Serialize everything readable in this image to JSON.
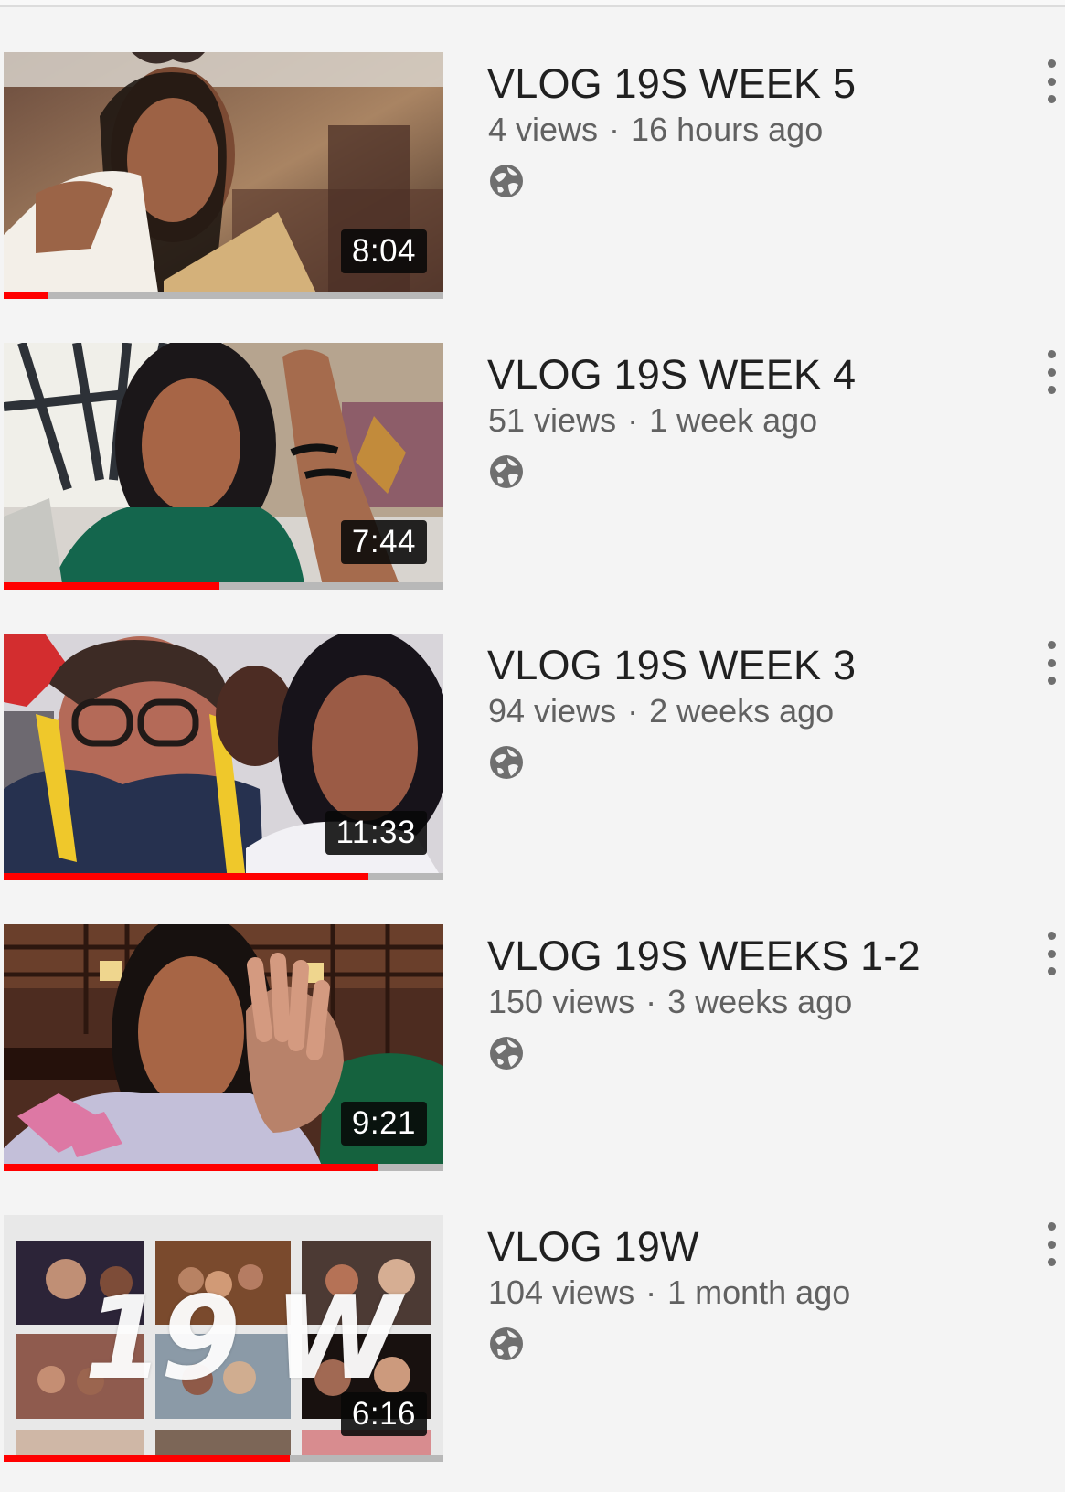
{
  "colors": {
    "background": "#f4f4f4",
    "title": "#202020",
    "meta": "#616161",
    "progress": "#ff0000",
    "duration_bg": "#080808",
    "icon": "#6f6f6f"
  },
  "videos": [
    {
      "title": "VLOG 19S WEEK 5",
      "views": "4 views",
      "separator": "·",
      "age": "16 hours ago",
      "duration": "8:04",
      "watched_fraction": 0.1,
      "visibility_icon": "globe-icon",
      "menu_icon": "more-vert-icon"
    },
    {
      "title": "VLOG 19S WEEK 4",
      "views": "51 views",
      "separator": "·",
      "age": "1 week ago",
      "duration": "7:44",
      "watched_fraction": 0.49,
      "visibility_icon": "globe-icon",
      "menu_icon": "more-vert-icon"
    },
    {
      "title": "VLOG 19S WEEK 3",
      "views": "94 views",
      "separator": "·",
      "age": "2 weeks ago",
      "duration": "11:33",
      "watched_fraction": 0.83,
      "visibility_icon": "globe-icon",
      "menu_icon": "more-vert-icon"
    },
    {
      "title": "VLOG 19S WEEKS 1-2",
      "views": "150 views",
      "separator": "·",
      "age": "3 weeks ago",
      "duration": "9:21",
      "watched_fraction": 0.85,
      "visibility_icon": "globe-icon",
      "menu_icon": "more-vert-icon"
    },
    {
      "title": "VLOG 19W",
      "views": "104 views",
      "separator": "·",
      "age": "1 month ago",
      "duration": "6:16",
      "watched_fraction": 0.65,
      "visibility_icon": "globe-icon",
      "menu_icon": "more-vert-icon",
      "thumbnail_text": "19 W"
    }
  ]
}
